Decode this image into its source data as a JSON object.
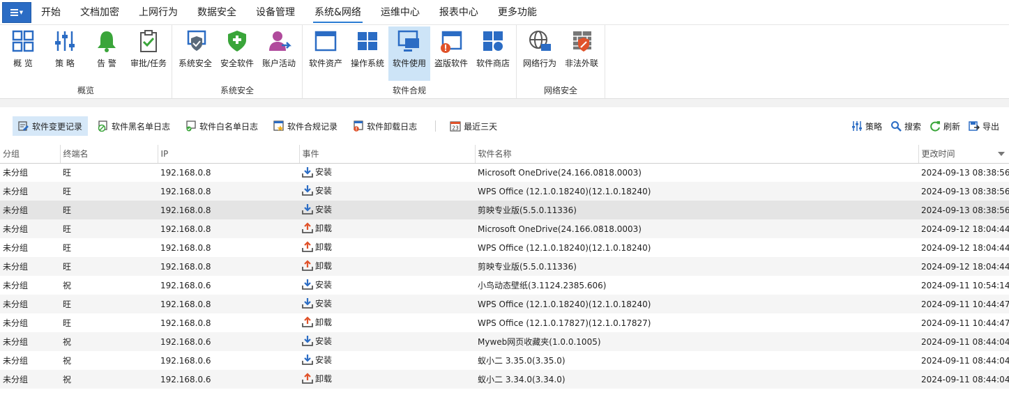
{
  "menu": {
    "tabs": [
      "开始",
      "文档加密",
      "上网行为",
      "数据安全",
      "设备管理",
      "系统&网络",
      "运维中心",
      "报表中心",
      "更多功能"
    ],
    "active_tab_index": 5
  },
  "ribbon": {
    "groups": [
      {
        "title": "概览",
        "items": [
          {
            "label": "概 览",
            "icon": "grid-icon"
          },
          {
            "label": "策 略",
            "icon": "sliders-icon"
          },
          {
            "label": "告 警",
            "icon": "bell-icon"
          },
          {
            "label": "审批/任务",
            "icon": "clipboard-check-icon"
          }
        ]
      },
      {
        "title": "系统安全",
        "items": [
          {
            "label": "系统安全",
            "icon": "monitor-shield-icon"
          },
          {
            "label": "安全软件",
            "icon": "shield-icon"
          },
          {
            "label": "账户活动",
            "icon": "user-activity-icon"
          }
        ]
      },
      {
        "title": "软件合规",
        "items": [
          {
            "label": "软件资产",
            "icon": "window-icon"
          },
          {
            "label": "操作系统",
            "icon": "windows-icon"
          },
          {
            "label": "软件使用",
            "icon": "monitor-icon"
          },
          {
            "label": "盗版软件",
            "icon": "window-alert-icon"
          },
          {
            "label": "软件商店",
            "icon": "store-icon"
          }
        ]
      },
      {
        "title": "网络安全",
        "items": [
          {
            "label": "网络行为",
            "icon": "globe-icon"
          },
          {
            "label": "非法外联",
            "icon": "firewall-icon"
          }
        ]
      }
    ],
    "active_item": "软件使用"
  },
  "toolbar": {
    "buttons": [
      {
        "label": "软件变更记录",
        "icon": "change-record-icon"
      },
      {
        "label": "软件黑名单日志",
        "icon": "blacklist-icon"
      },
      {
        "label": "软件白名单日志",
        "icon": "whitelist-icon"
      },
      {
        "label": "软件合规记录",
        "icon": "compliance-icon"
      },
      {
        "label": "软件卸载日志",
        "icon": "uninstall-log-icon"
      }
    ],
    "date_filter": {
      "label": "最近三天",
      "icon_text": "23"
    },
    "right": [
      {
        "label": "策略",
        "icon": "sliders-icon"
      },
      {
        "label": "搜索",
        "icon": "search-icon"
      },
      {
        "label": "刷新",
        "icon": "refresh-icon"
      },
      {
        "label": "导出",
        "icon": "export-icon"
      }
    ]
  },
  "table": {
    "columns": [
      "分组",
      "终端名",
      "IP",
      "事件",
      "软件名称",
      "更改时间"
    ],
    "rows": [
      {
        "group": "未分组",
        "terminal": "旺",
        "ip": "192.168.0.8",
        "event": "安装",
        "type": "install",
        "software": "Microsoft OneDrive(24.166.0818.0003)",
        "time": "2024-09-13 08:38:56"
      },
      {
        "group": "未分组",
        "terminal": "旺",
        "ip": "192.168.0.8",
        "event": "安装",
        "type": "install",
        "software": "WPS Office (12.1.0.18240)(12.1.0.18240)",
        "time": "2024-09-13 08:38:56"
      },
      {
        "group": "未分组",
        "terminal": "旺",
        "ip": "192.168.0.8",
        "event": "安装",
        "type": "install",
        "software": "剪映专业版(5.5.0.11336)",
        "time": "2024-09-13 08:38:56"
      },
      {
        "group": "未分组",
        "terminal": "旺",
        "ip": "192.168.0.8",
        "event": "卸载",
        "type": "uninstall",
        "software": "Microsoft OneDrive(24.166.0818.0003)",
        "time": "2024-09-12 18:04:44"
      },
      {
        "group": "未分组",
        "terminal": "旺",
        "ip": "192.168.0.8",
        "event": "卸载",
        "type": "uninstall",
        "software": "WPS Office (12.1.0.18240)(12.1.0.18240)",
        "time": "2024-09-12 18:04:44"
      },
      {
        "group": "未分组",
        "terminal": "旺",
        "ip": "192.168.0.8",
        "event": "卸载",
        "type": "uninstall",
        "software": "剪映专业版(5.5.0.11336)",
        "time": "2024-09-12 18:04:44"
      },
      {
        "group": "未分组",
        "terminal": "祝",
        "ip": "192.168.0.6",
        "event": "安装",
        "type": "install",
        "software": "小鸟动态壁纸(3.1124.2385.606)",
        "time": "2024-09-11 10:54:14"
      },
      {
        "group": "未分组",
        "terminal": "旺",
        "ip": "192.168.0.8",
        "event": "安装",
        "type": "install",
        "software": "WPS Office (12.1.0.18240)(12.1.0.18240)",
        "time": "2024-09-11 10:44:47"
      },
      {
        "group": "未分组",
        "terminal": "旺",
        "ip": "192.168.0.8",
        "event": "卸载",
        "type": "uninstall",
        "software": "WPS Office (12.1.0.17827)(12.1.0.17827)",
        "time": "2024-09-11 10:44:47"
      },
      {
        "group": "未分组",
        "terminal": "祝",
        "ip": "192.168.0.6",
        "event": "安装",
        "type": "install",
        "software": "Myweb网页收藏夹(1.0.0.1005)",
        "time": "2024-09-11 08:44:04"
      },
      {
        "group": "未分组",
        "terminal": "祝",
        "ip": "192.168.0.6",
        "event": "安装",
        "type": "install",
        "software": "蚁小二 3.35.0(3.35.0)",
        "time": "2024-09-11 08:44:04"
      },
      {
        "group": "未分组",
        "terminal": "祝",
        "ip": "192.168.0.6",
        "event": "卸载",
        "type": "uninstall",
        "software": "蚁小二 3.34.0(3.34.0)",
        "time": "2024-09-11 08:44:04"
      }
    ],
    "selected_row_index": 2
  },
  "colors": {
    "accent": "#2b7cd3",
    "install": "#2b6cc4",
    "uninstall": "#e0522a",
    "selected_toolbar": "#d6e8f8"
  }
}
